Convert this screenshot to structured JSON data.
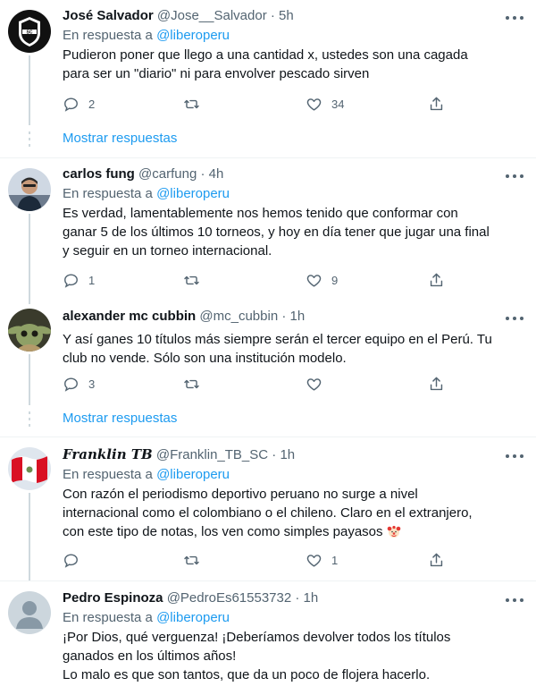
{
  "tweets": [
    {
      "name": "José Salvador",
      "handle": "@Jose__Salvador",
      "dot": "·",
      "time": "5h",
      "reply_prefix": "En respuesta a",
      "reply_to": "@liberoperu",
      "lines": [
        "Pudieron poner que llego a una cantidad x, ustedes son una cagada",
        "para ser un \"diario\" ni para envolver pescado sirven"
      ],
      "replies": "2",
      "retweets": "",
      "likes": "34",
      "avatar": "sporting-cristal-logo"
    },
    {
      "name": "carlos fung",
      "handle": "@carfung",
      "dot": "·",
      "time": "4h",
      "reply_prefix": "En respuesta a",
      "reply_to": "@liberoperu",
      "lines": [
        "Es verdad, lamentablemente nos hemos tenido que conformar con",
        "ganar 5 de los últimos 10 torneos, y hoy en día tener que jugar una final",
        "y seguir en un torneo internacional."
      ],
      "replies": "1",
      "retweets": "",
      "likes": "9",
      "avatar": "photo-person"
    },
    {
      "name": "alexander mc cubbin",
      "handle": "@mc_cubbin",
      "dot": "·",
      "time": "1h",
      "lines": [
        "Y así ganes 10 títulos más siempre serán el tercer equipo en el Perú. Tu",
        "club no vende. Sólo son una institución modelo."
      ],
      "replies": "3",
      "retweets": "",
      "likes": "",
      "avatar": "baby-yoda-photo"
    },
    {
      "name": "Franklin TB",
      "handle": "@Franklin_TB_SC",
      "dot": "·",
      "time": "1h",
      "reply_prefix": "En respuesta a",
      "reply_to": "@liberoperu",
      "lines": [
        "Con razón el periodismo deportivo peruano no surge a nivel",
        "internacional como el colombiano o el chileno. Claro en el extranjero,",
        "con este tipo de notas, los ven como simples payasos"
      ],
      "emoji": "clown-face-emoji",
      "replies": "",
      "retweets": "",
      "likes": "1",
      "avatar": "peru-flag"
    },
    {
      "name": "Pedro Espinoza",
      "handle": "@PedroEs61553732",
      "dot": "·",
      "time": "1h",
      "reply_prefix": "En respuesta a",
      "reply_to": "@liberoperu",
      "lines": [
        "¡Por Dios, qué verguenza! ¡Deberíamos devolver todos los títulos",
        "ganados en los últimos años!",
        "Lo malo es que son tantos, que da un poco de flojera hacerlo."
      ],
      "avatar": "default-avatar"
    }
  ],
  "show_replies_label": "Mostrar respuestas",
  "colors": {
    "link": "#1d9bf0",
    "secondary": "#536471",
    "text": "#0f1419",
    "divider": "#eff3f4",
    "thread": "#cfd9de"
  }
}
